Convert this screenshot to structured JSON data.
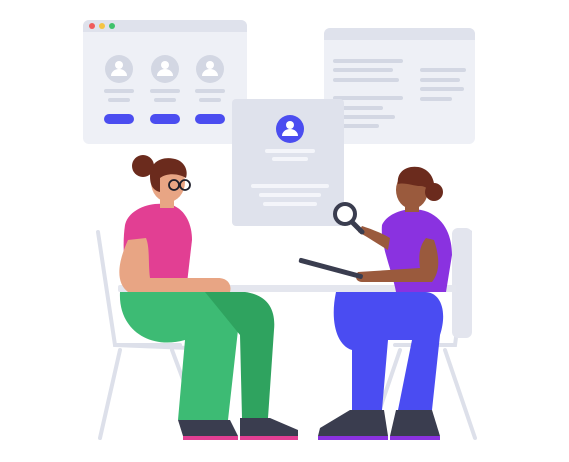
{
  "colors": {
    "card_bg": "#eef0f6",
    "card_header": "#dfe2ec",
    "placeholder": "#d3d7e3",
    "accent": "#4b4df0",
    "window_red": "#f05b5b",
    "window_yellow": "#f5c443",
    "window_green": "#3fc26b",
    "skin": "#e8a584",
    "skin_dark": "#9a5a3d",
    "hair": "#6b2b1d",
    "pink_top": "#e23f93",
    "green_pants": "#3dbb74",
    "purple_top": "#8a32e0",
    "blue_pants": "#4a4cf2",
    "shoes": "#3a3d4f",
    "chair": "#dde0ea",
    "table": "#e4e6ee"
  },
  "icons": {
    "window_card": [
      "user-avatar-icon",
      "user-avatar-icon",
      "user-avatar-icon"
    ],
    "center_card": "user-avatar-icon",
    "magnifier": "magnifying-glass-icon"
  }
}
